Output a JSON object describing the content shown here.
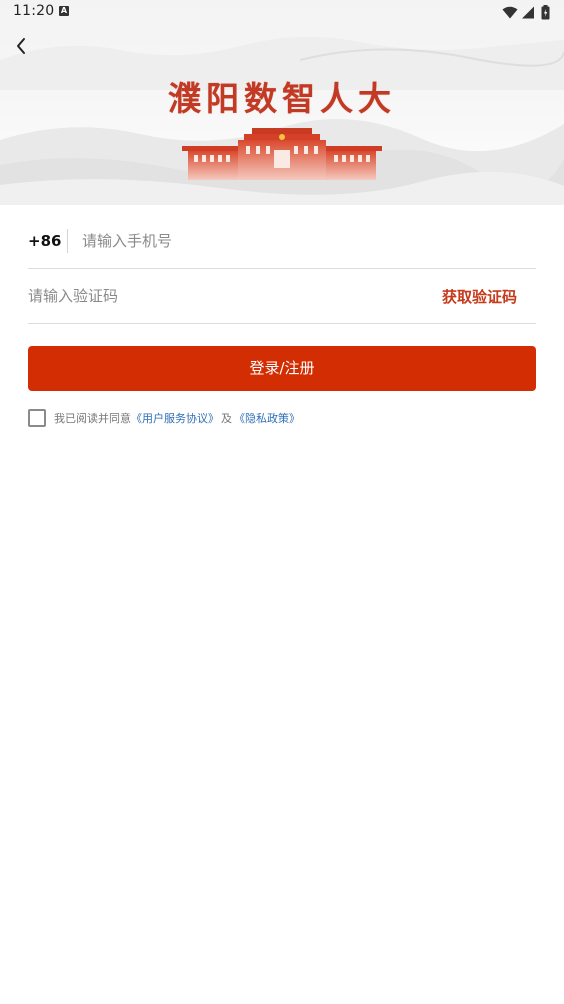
{
  "status_bar": {
    "time": "11:20",
    "notification_icon": "a-box-icon",
    "icons": [
      "wifi-icon",
      "cell-signal-icon",
      "battery-icon"
    ]
  },
  "header": {
    "back_icon": "chevron-left-icon",
    "app_title": "濮阳数智人大",
    "illustration": "building-illustration"
  },
  "form": {
    "country_code": "+86",
    "phone_placeholder": "请输入手机号",
    "phone_value": "",
    "code_placeholder": "请输入验证码",
    "code_value": "",
    "get_code_label": "获取验证码",
    "login_label": "登录/注册"
  },
  "agreement": {
    "checked": false,
    "prefix": "我已阅读并同意",
    "user_agreement": "《用户服务协议》",
    "conjunction": "及",
    "privacy_policy": "《隐私政策》"
  },
  "colors": {
    "accent": "#d22d03",
    "get_code": "#c63a1c",
    "link": "#2f6fb6",
    "title": "#c23a24"
  }
}
